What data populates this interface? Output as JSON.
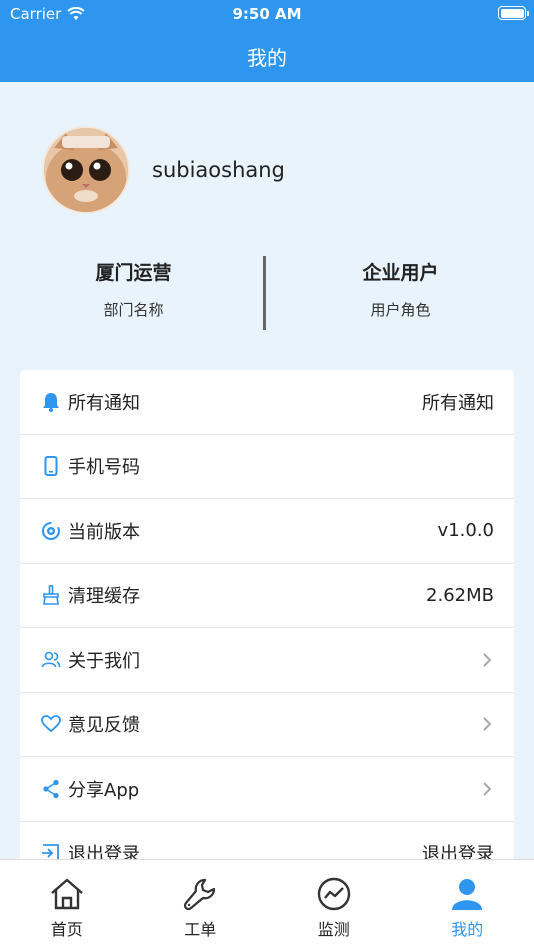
{
  "status_bar": {
    "carrier": "Carrier",
    "time": "9:50 AM"
  },
  "nav": {
    "title": "我的"
  },
  "profile": {
    "username": "subiaoshang"
  },
  "stats": [
    {
      "value": "厦门运营",
      "label": "部门名称"
    },
    {
      "value": "企业用户",
      "label": "用户角色"
    }
  ],
  "menu": [
    {
      "icon": "bell-icon",
      "title": "所有通知",
      "value": "所有通知"
    },
    {
      "icon": "phone-icon",
      "title": "手机号码",
      "value": ""
    },
    {
      "icon": "version-gear-icon",
      "title": "当前版本",
      "value": "v1.0.0"
    },
    {
      "icon": "broom-icon",
      "title": "清理缓存",
      "value": "2.62MB"
    },
    {
      "icon": "users-icon",
      "title": "关于我们",
      "value": ""
    },
    {
      "icon": "heart-icon",
      "title": "意见反馈",
      "value": ""
    },
    {
      "icon": "share-icon",
      "title": "分享App",
      "value": ""
    },
    {
      "icon": "logout-icon",
      "title": "退出登录",
      "value": "退出登录"
    }
  ],
  "tabs": [
    {
      "icon": "home-icon",
      "label": "首页"
    },
    {
      "icon": "wrench-icon",
      "label": "工单"
    },
    {
      "icon": "monitor-icon",
      "label": "监测"
    },
    {
      "icon": "user-icon",
      "label": "我的"
    }
  ],
  "colors": {
    "accent": "#2e96ee",
    "background": "#e8f3fb"
  }
}
